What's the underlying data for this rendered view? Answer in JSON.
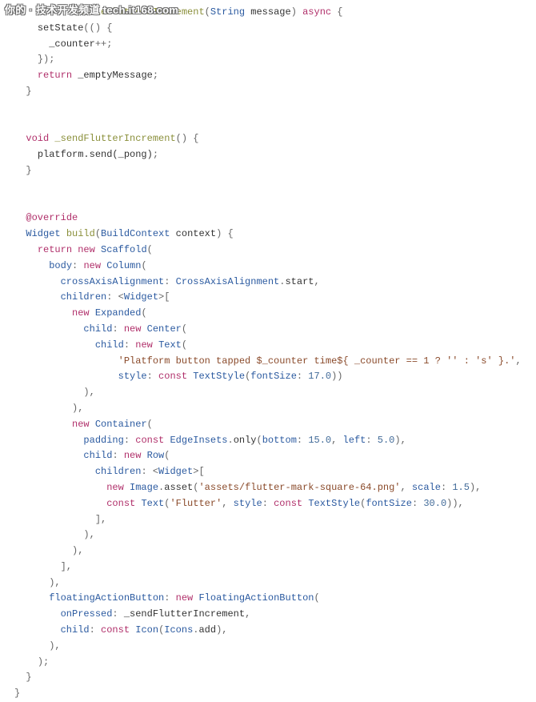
{
  "watermark": "你的 · 技术开发频道 tech.it168.com",
  "code": {
    "lines": [
      [
        [
          "sp",
          "          "
        ],
        [
          "name",
          "handlePlatformIncrement"
        ],
        [
          "punc",
          "("
        ],
        [
          "type",
          "String"
        ],
        [
          "plain",
          " message"
        ],
        [
          "punc",
          ") "
        ],
        [
          "kw",
          "async"
        ],
        [
          "punc",
          " {"
        ]
      ],
      [
        [
          "sp",
          "    "
        ],
        [
          "plain",
          "setState"
        ],
        [
          "punc",
          "(() {"
        ]
      ],
      [
        [
          "sp",
          "      "
        ],
        [
          "plain",
          "_counter"
        ],
        [
          "op",
          "++"
        ],
        [
          "punc",
          ";"
        ]
      ],
      [
        [
          "sp",
          "    "
        ],
        [
          "punc",
          "});"
        ]
      ],
      [
        [
          "sp",
          "    "
        ],
        [
          "kw",
          "return"
        ],
        [
          "plain",
          " _emptyMessage"
        ],
        [
          "punc",
          ";"
        ]
      ],
      [
        [
          "sp",
          "  "
        ],
        [
          "punc",
          "}"
        ]
      ],
      [
        [
          "sp",
          ""
        ]
      ],
      [
        [
          "sp",
          ""
        ]
      ],
      [
        [
          "sp",
          "  "
        ],
        [
          "kw",
          "void"
        ],
        [
          "plain",
          " "
        ],
        [
          "name",
          "_sendFlutterIncrement"
        ],
        [
          "punc",
          "() {"
        ]
      ],
      [
        [
          "sp",
          "    "
        ],
        [
          "plain",
          "platform.send(_pong)"
        ],
        [
          "punc",
          ";"
        ]
      ],
      [
        [
          "sp",
          "  "
        ],
        [
          "punc",
          "}"
        ]
      ],
      [
        [
          "sp",
          ""
        ]
      ],
      [
        [
          "sp",
          ""
        ]
      ],
      [
        [
          "sp",
          "  "
        ],
        [
          "anno",
          "@override"
        ]
      ],
      [
        [
          "sp",
          "  "
        ],
        [
          "type",
          "Widget"
        ],
        [
          "plain",
          " "
        ],
        [
          "name",
          "build"
        ],
        [
          "punc",
          "("
        ],
        [
          "type",
          "BuildContext"
        ],
        [
          "plain",
          " context"
        ],
        [
          "punc",
          ") {"
        ]
      ],
      [
        [
          "sp",
          "    "
        ],
        [
          "kw",
          "return"
        ],
        [
          "plain",
          " "
        ],
        [
          "kw",
          "new"
        ],
        [
          "plain",
          " "
        ],
        [
          "type",
          "Scaffold"
        ],
        [
          "punc",
          "("
        ]
      ],
      [
        [
          "sp",
          "      "
        ],
        [
          "param",
          "body"
        ],
        [
          "punc",
          ": "
        ],
        [
          "kw",
          "new"
        ],
        [
          "plain",
          " "
        ],
        [
          "type",
          "Column"
        ],
        [
          "punc",
          "("
        ]
      ],
      [
        [
          "sp",
          "        "
        ],
        [
          "param",
          "crossAxisAlignment"
        ],
        [
          "punc",
          ": "
        ],
        [
          "type",
          "CrossAxisAlignment"
        ],
        [
          "punc",
          "."
        ],
        [
          "plain",
          "start"
        ],
        [
          "punc",
          ","
        ]
      ],
      [
        [
          "sp",
          "        "
        ],
        [
          "param",
          "children"
        ],
        [
          "punc",
          ": <"
        ],
        [
          "type",
          "Widget"
        ],
        [
          "punc",
          ">["
        ]
      ],
      [
        [
          "sp",
          "          "
        ],
        [
          "kw",
          "new"
        ],
        [
          "plain",
          " "
        ],
        [
          "type",
          "Expanded"
        ],
        [
          "punc",
          "("
        ]
      ],
      [
        [
          "sp",
          "            "
        ],
        [
          "param",
          "child"
        ],
        [
          "punc",
          ": "
        ],
        [
          "kw",
          "new"
        ],
        [
          "plain",
          " "
        ],
        [
          "type",
          "Center"
        ],
        [
          "punc",
          "("
        ]
      ],
      [
        [
          "sp",
          "              "
        ],
        [
          "param",
          "child"
        ],
        [
          "punc",
          ": "
        ],
        [
          "kw",
          "new"
        ],
        [
          "plain",
          " "
        ],
        [
          "type",
          "Text"
        ],
        [
          "punc",
          "("
        ]
      ],
      [
        [
          "sp",
          "                  "
        ],
        [
          "str",
          "'Platform button tapped $_counter time${ _counter == 1 ? '' : 's' }.'"
        ],
        [
          "punc",
          ","
        ]
      ],
      [
        [
          "sp",
          "                  "
        ],
        [
          "param",
          "style"
        ],
        [
          "punc",
          ": "
        ],
        [
          "kw",
          "const"
        ],
        [
          "plain",
          " "
        ],
        [
          "type",
          "TextStyle"
        ],
        [
          "punc",
          "("
        ],
        [
          "param",
          "fontSize"
        ],
        [
          "punc",
          ": "
        ],
        [
          "num",
          "17.0"
        ],
        [
          "punc",
          "))"
        ]
      ],
      [
        [
          "sp",
          "            "
        ],
        [
          "punc",
          "),"
        ]
      ],
      [
        [
          "sp",
          "          "
        ],
        [
          "punc",
          "),"
        ]
      ],
      [
        [
          "sp",
          "          "
        ],
        [
          "kw",
          "new"
        ],
        [
          "plain",
          " "
        ],
        [
          "type",
          "Container"
        ],
        [
          "punc",
          "("
        ]
      ],
      [
        [
          "sp",
          "            "
        ],
        [
          "param",
          "padding"
        ],
        [
          "punc",
          ": "
        ],
        [
          "kw",
          "const"
        ],
        [
          "plain",
          " "
        ],
        [
          "type",
          "EdgeInsets"
        ],
        [
          "punc",
          "."
        ],
        [
          "plain",
          "only"
        ],
        [
          "punc",
          "("
        ],
        [
          "param",
          "bottom"
        ],
        [
          "punc",
          ": "
        ],
        [
          "num",
          "15.0"
        ],
        [
          "punc",
          ", "
        ],
        [
          "param",
          "left"
        ],
        [
          "punc",
          ": "
        ],
        [
          "num",
          "5.0"
        ],
        [
          "punc",
          "),"
        ]
      ],
      [
        [
          "sp",
          "            "
        ],
        [
          "param",
          "child"
        ],
        [
          "punc",
          ": "
        ],
        [
          "kw",
          "new"
        ],
        [
          "plain",
          " "
        ],
        [
          "type",
          "Row"
        ],
        [
          "punc",
          "("
        ]
      ],
      [
        [
          "sp",
          "              "
        ],
        [
          "param",
          "children"
        ],
        [
          "punc",
          ": <"
        ],
        [
          "type",
          "Widget"
        ],
        [
          "punc",
          ">["
        ]
      ],
      [
        [
          "sp",
          "                "
        ],
        [
          "kw",
          "new"
        ],
        [
          "plain",
          " "
        ],
        [
          "type",
          "Image"
        ],
        [
          "punc",
          "."
        ],
        [
          "plain",
          "asset"
        ],
        [
          "punc",
          "("
        ],
        [
          "str",
          "'assets/flutter-mark-square-64.png'"
        ],
        [
          "punc",
          ", "
        ],
        [
          "param",
          "scale"
        ],
        [
          "punc",
          ": "
        ],
        [
          "num",
          "1.5"
        ],
        [
          "punc",
          "),"
        ]
      ],
      [
        [
          "sp",
          "                "
        ],
        [
          "kw",
          "const"
        ],
        [
          "plain",
          " "
        ],
        [
          "type",
          "Text"
        ],
        [
          "punc",
          "("
        ],
        [
          "str",
          "'Flutter'"
        ],
        [
          "punc",
          ", "
        ],
        [
          "param",
          "style"
        ],
        [
          "punc",
          ": "
        ],
        [
          "kw",
          "const"
        ],
        [
          "plain",
          " "
        ],
        [
          "type",
          "TextStyle"
        ],
        [
          "punc",
          "("
        ],
        [
          "param",
          "fontSize"
        ],
        [
          "punc",
          ": "
        ],
        [
          "num",
          "30.0"
        ],
        [
          "punc",
          ")),"
        ]
      ],
      [
        [
          "sp",
          "              "
        ],
        [
          "punc",
          "],"
        ]
      ],
      [
        [
          "sp",
          "            "
        ],
        [
          "punc",
          "),"
        ]
      ],
      [
        [
          "sp",
          "          "
        ],
        [
          "punc",
          "),"
        ]
      ],
      [
        [
          "sp",
          "        "
        ],
        [
          "punc",
          "],"
        ]
      ],
      [
        [
          "sp",
          "      "
        ],
        [
          "punc",
          "),"
        ]
      ],
      [
        [
          "sp",
          "      "
        ],
        [
          "param",
          "floatingActionButton"
        ],
        [
          "punc",
          ": "
        ],
        [
          "kw",
          "new"
        ],
        [
          "plain",
          " "
        ],
        [
          "type",
          "FloatingActionButton"
        ],
        [
          "punc",
          "("
        ]
      ],
      [
        [
          "sp",
          "        "
        ],
        [
          "param",
          "onPressed"
        ],
        [
          "punc",
          ": "
        ],
        [
          "plain",
          "_sendFlutterIncrement"
        ],
        [
          "punc",
          ","
        ]
      ],
      [
        [
          "sp",
          "        "
        ],
        [
          "param",
          "child"
        ],
        [
          "punc",
          ": "
        ],
        [
          "kw",
          "const"
        ],
        [
          "plain",
          " "
        ],
        [
          "type",
          "Icon"
        ],
        [
          "punc",
          "("
        ],
        [
          "type",
          "Icons"
        ],
        [
          "punc",
          "."
        ],
        [
          "plain",
          "add"
        ],
        [
          "punc",
          "),"
        ]
      ],
      [
        [
          "sp",
          "      "
        ],
        [
          "punc",
          "),"
        ]
      ],
      [
        [
          "sp",
          "    "
        ],
        [
          "punc",
          ");"
        ]
      ],
      [
        [
          "sp",
          "  "
        ],
        [
          "punc",
          "}"
        ]
      ],
      [
        [
          "punc",
          "}"
        ]
      ]
    ]
  }
}
